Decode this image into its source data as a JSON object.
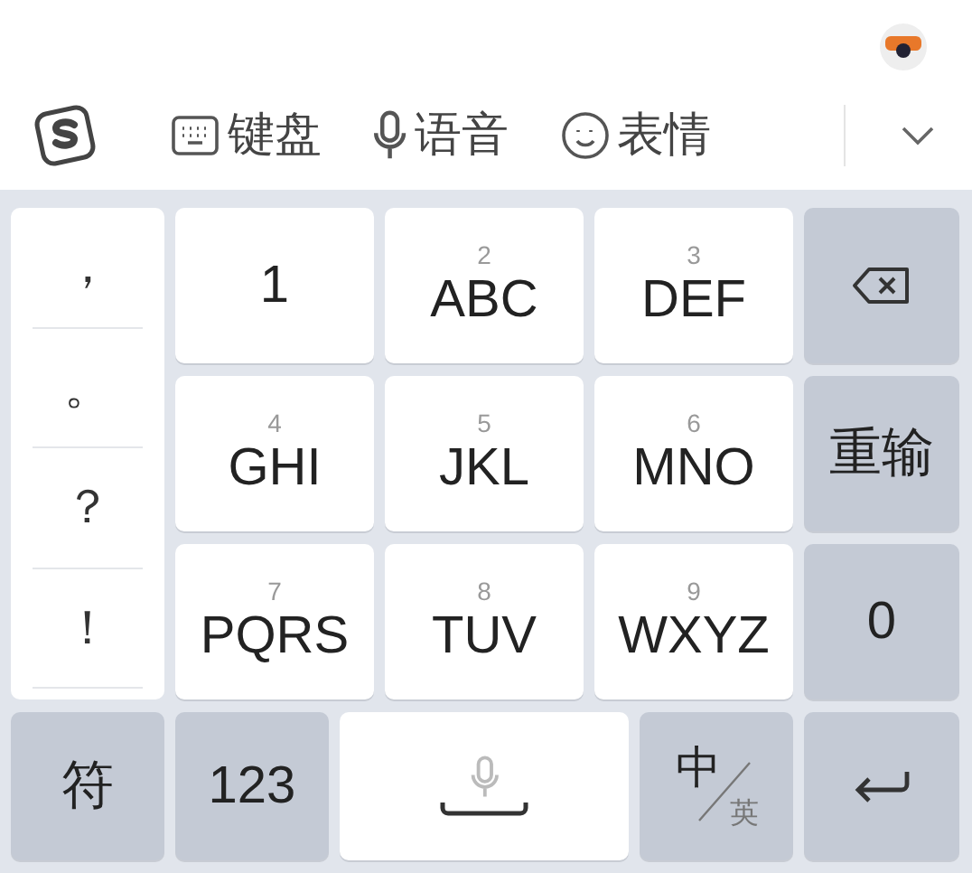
{
  "toolbar": {
    "items": [
      {
        "kind": "keyboard",
        "label": "键盘"
      },
      {
        "kind": "voice",
        "label": "语音"
      },
      {
        "kind": "emoji",
        "label": "表情"
      }
    ]
  },
  "punctuation": [
    "，",
    "。",
    "？",
    "！"
  ],
  "keys": [
    {
      "kind": "letters",
      "label": "1"
    },
    {
      "kind": "letters",
      "number": "2",
      "label": "ABC"
    },
    {
      "kind": "letters",
      "number": "3",
      "label": "DEF"
    },
    {
      "kind": "backspace"
    },
    {
      "kind": "letters",
      "number": "4",
      "label": "GHI"
    },
    {
      "kind": "letters",
      "number": "5",
      "label": "JKL"
    },
    {
      "kind": "letters",
      "number": "6",
      "label": "MNO"
    },
    {
      "kind": "action",
      "label": "重输"
    },
    {
      "kind": "letters",
      "number": "7",
      "label": "PQRS"
    },
    {
      "kind": "letters",
      "number": "8",
      "label": "TUV"
    },
    {
      "kind": "letters",
      "number": "9",
      "label": "WXYZ"
    },
    {
      "kind": "action",
      "label": "0"
    }
  ],
  "bottom_row": [
    {
      "kind": "action",
      "label": "符"
    },
    {
      "kind": "action",
      "label": "123"
    },
    {
      "kind": "space"
    },
    {
      "kind": "lang",
      "label": "中",
      "sublabel": "英"
    },
    {
      "kind": "enter"
    }
  ]
}
